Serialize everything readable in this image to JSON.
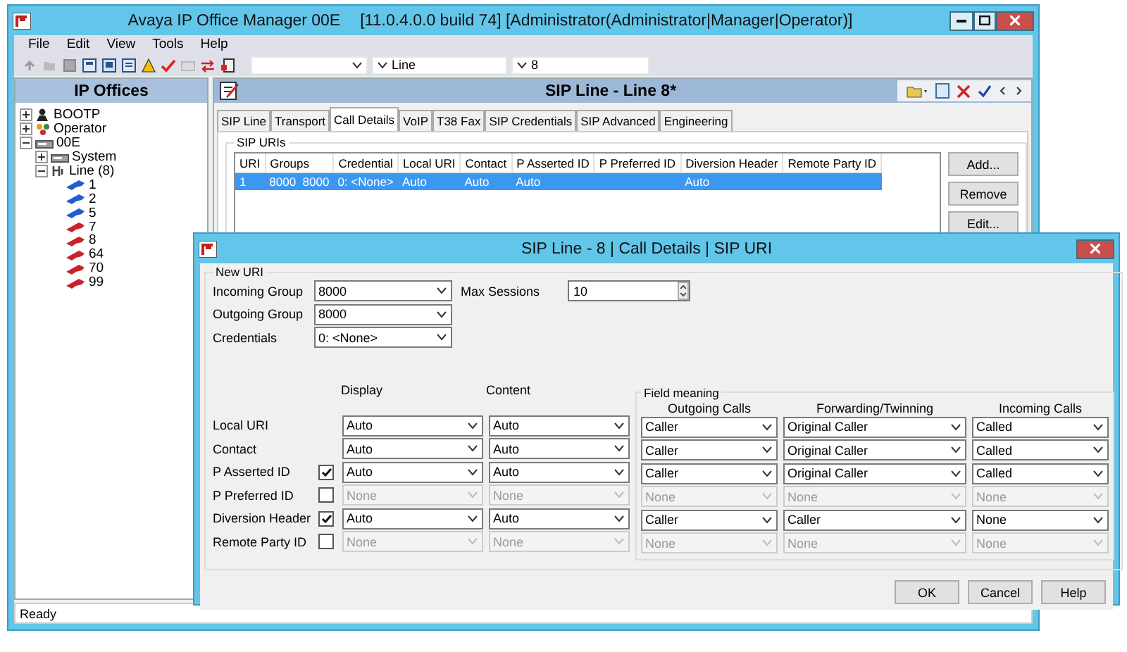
{
  "window": {
    "title": "Avaya IP Office Manager 00E",
    "title_suffix": "[11.0.4.0.0 build 74] [Administrator(Administrator|Manager|Operator)]"
  },
  "menu": [
    "File",
    "Edit",
    "View",
    "Tools",
    "Help"
  ],
  "toolbar": {
    "combos": [
      {
        "kind": "empty"
      },
      {
        "kind": "filled",
        "value": "Line"
      },
      {
        "kind": "filled",
        "value": "8"
      }
    ]
  },
  "sidebar": {
    "title": "IP Offices",
    "tree": [
      {
        "label": "BOOTP",
        "kind": "bootp",
        "expanded": false
      },
      {
        "label": "Operator",
        "kind": "operator",
        "expanded": false
      },
      {
        "label": "00E",
        "kind": "unit",
        "expanded": true,
        "children": [
          {
            "label": "System",
            "kind": "unit",
            "expanded": false
          },
          {
            "label": "Line (8)",
            "kind": "line",
            "expanded": true,
            "children": [
              {
                "label": "1",
                "kind": "trunk",
                "color": "#1f5fc8"
              },
              {
                "label": "2",
                "kind": "trunk",
                "color": "#1f5fc8"
              },
              {
                "label": "5",
                "kind": "trunk",
                "color": "#1f5fc8"
              },
              {
                "label": "7",
                "kind": "trunk",
                "color": "#c8232c"
              },
              {
                "label": "8",
                "kind": "trunk",
                "color": "#c8232c"
              },
              {
                "label": "64",
                "kind": "trunk",
                "color": "#c8232c"
              },
              {
                "label": "70",
                "kind": "trunk",
                "color": "#c8232c"
              },
              {
                "label": "99",
                "kind": "trunk",
                "color": "#c8232c"
              }
            ]
          }
        ]
      }
    ]
  },
  "editor": {
    "title": "SIP Line - Line 8*",
    "tabs": [
      {
        "label": "SIP Line",
        "selected": false
      },
      {
        "label": "Transport",
        "selected": false
      },
      {
        "label": "Call Details",
        "selected": true
      },
      {
        "label": "VoIP",
        "selected": false
      },
      {
        "label": "T38 Fax",
        "selected": false
      },
      {
        "label": "SIP Credentials",
        "selected": false
      },
      {
        "label": "SIP Advanced",
        "selected": false
      },
      {
        "label": "Engineering",
        "selected": false
      }
    ],
    "group": "SIP URIs",
    "table": {
      "columns": [
        "URI",
        "Groups",
        "Credential",
        "Local URI",
        "Contact",
        "P Asserted ID",
        "P Preferred ID",
        "Diversion Header",
        "Remote Party ID"
      ],
      "rows": [
        {
          "selected": true,
          "cells": [
            "1",
            "8000  8000",
            "0: <None>",
            "Auto",
            "Auto",
            "Auto",
            null,
            "Auto",
            null
          ]
        }
      ]
    },
    "buttons": [
      "Add...",
      "Remove",
      "Edit..."
    ]
  },
  "status_bar": "Ready",
  "dialog": {
    "title": "SIP Line - 8 | Call Details | SIP URI",
    "group": "New URI",
    "fields": [
      {
        "label": "Incoming Group",
        "value": "8000"
      },
      {
        "label": "Outgoing Group",
        "value": "8000"
      },
      {
        "label": "Credentials",
        "value": "0: <None>"
      }
    ],
    "max_sessions": {
      "label": "Max Sessions",
      "value": "10"
    },
    "headers": [
      "Display",
      "Content"
    ],
    "field_meaning": {
      "title": "Field meaning",
      "headers": [
        "Outgoing Calls",
        "Forwarding/Twinning",
        "Incoming Calls"
      ]
    },
    "rows": [
      {
        "label": "Local URI",
        "kind": "plain",
        "display": "Auto",
        "content": "Auto",
        "outgoing": "Caller",
        "forwarding": "Original Caller",
        "incoming": "Called"
      },
      {
        "label": "Contact",
        "kind": "plain",
        "display": "Auto",
        "content": "Auto",
        "outgoing": "Caller",
        "forwarding": "Original Caller",
        "incoming": "Called"
      },
      {
        "label": "P Asserted ID",
        "kind": "checkbox",
        "checked": true,
        "display": "Auto",
        "content": "Auto",
        "outgoing": "Caller",
        "forwarding": "Original Caller",
        "incoming": "Called"
      },
      {
        "label": "P Preferred  ID",
        "kind": "checkbox",
        "checked": false,
        "display": "None",
        "content": "None",
        "outgoing": "None",
        "forwarding": "None",
        "incoming": "None"
      },
      {
        "label": "Diversion Header",
        "kind": "checkbox",
        "checked": true,
        "display": "Auto",
        "content": "Auto",
        "outgoing": "Caller",
        "forwarding": "Caller",
        "incoming": "None"
      },
      {
        "label": "Remote Party ID",
        "kind": "checkbox",
        "checked": false,
        "display": "None",
        "content": "None",
        "outgoing": "None",
        "forwarding": "None",
        "incoming": "None"
      }
    ],
    "buttons": [
      "OK",
      "Cancel",
      "Help"
    ]
  }
}
